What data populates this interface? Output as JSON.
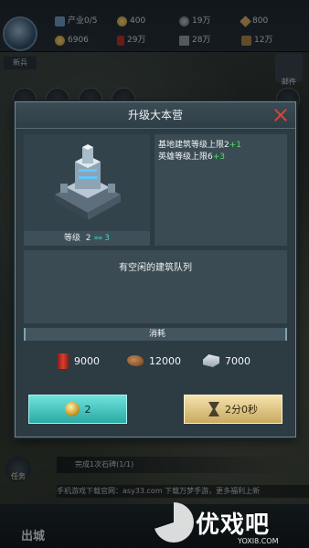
{
  "player": {
    "rank": "新兵"
  },
  "resources": [
    {
      "icon": "industry-icon",
      "value": "产业0/5"
    },
    {
      "icon": "gold-coin-icon",
      "value": "400"
    },
    {
      "icon": "gear-icon",
      "value": "19万"
    },
    {
      "icon": "diamond-icon",
      "value": "800"
    },
    {
      "icon": "population-icon",
      "value": "6906"
    },
    {
      "icon": "oil-icon",
      "value": "29万"
    },
    {
      "icon": "steel-icon",
      "value": "28万"
    },
    {
      "icon": "ore-icon",
      "value": "12万"
    }
  ],
  "mail_label": "邮件",
  "dialog": {
    "title": "升级大本营",
    "level_label": "等级",
    "level_current": "2",
    "level_arrow": "»»",
    "level_next": "3",
    "bonus": [
      {
        "text": "基地建筑等级上限2",
        "plus": "+1"
      },
      {
        "text": "英雄等级上限6",
        "plus": "+3"
      }
    ],
    "queue_text": "有空闲的建筑队列",
    "cost_label": "消耗",
    "costs": [
      {
        "icon": "oil-barrel-icon",
        "value": "9000"
      },
      {
        "icon": "ore-icon",
        "value": "12000"
      },
      {
        "icon": "steel-icon",
        "value": "7000"
      }
    ],
    "gold_button_value": "2",
    "time_button_value": "2分0秒"
  },
  "task_label": "任务",
  "quest_text": "完成1次石碑(1/1)",
  "scroll_notice": "手机游戏下载官网：asy33.com 下载万梦手游，更多福利上新",
  "bottom_go_label": "出城",
  "watermark": {
    "brand": "优戏吧",
    "url": "YOXI8.COM"
  },
  "colors": {
    "accent_teal": "#3fd3c7",
    "bonus_green": "#4fe06a",
    "close_red": "#d8453a",
    "gold_button": "#2aa9a3",
    "time_button": "#c8a960"
  }
}
